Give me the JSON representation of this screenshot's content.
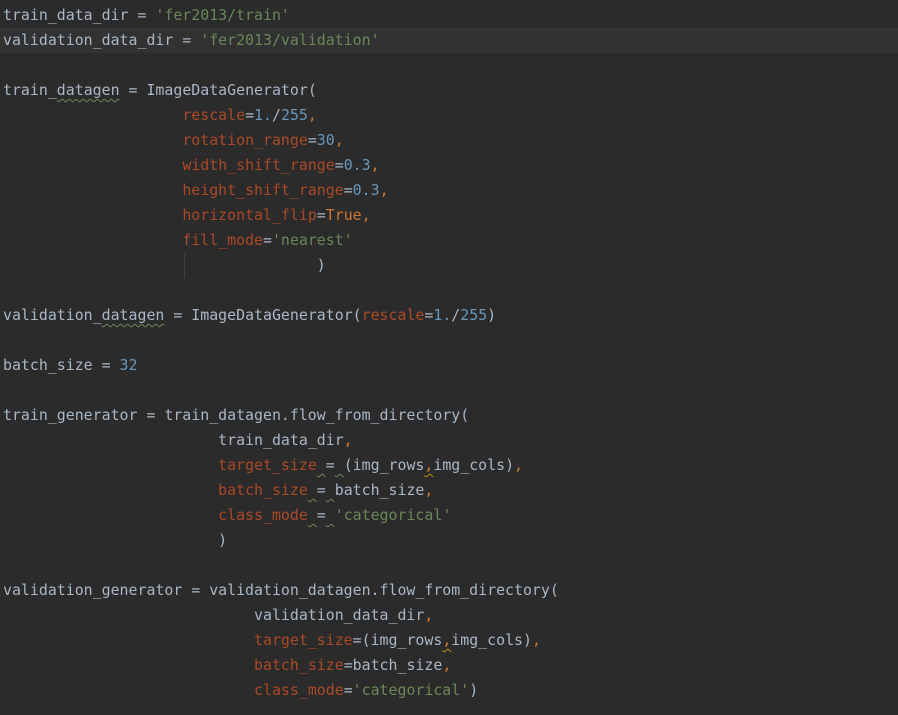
{
  "editor": {
    "theme": {
      "background": "#2b2b2b",
      "current_line": "#323232",
      "default_text": "#a9b7c6",
      "string": "#6a8759",
      "number": "#6897bb",
      "parameter": "#aa4926",
      "keyword_punct": "#cc7832"
    },
    "current_line_index": 1,
    "lines": [
      [
        {
          "t": "train_data_dir = ",
          "k": "default"
        },
        {
          "t": "'fer2013/train'",
          "k": "string"
        }
      ],
      [
        {
          "t": "validation_data_dir = ",
          "k": "default"
        },
        {
          "t": "'fer2013/validation'",
          "k": "string"
        }
      ],
      [],
      [
        {
          "t": "train_",
          "k": "default"
        },
        {
          "t": "datagen",
          "k": "default",
          "u": "weak"
        },
        {
          "t": " = ImageDataGenerator(",
          "k": "default"
        }
      ],
      [
        {
          "t": "                    ",
          "k": "default"
        },
        {
          "t": "rescale",
          "k": "param"
        },
        {
          "t": "=",
          "k": "default"
        },
        {
          "t": "1.",
          "k": "number"
        },
        {
          "t": "/",
          "k": "default"
        },
        {
          "t": "255",
          "k": "number"
        },
        {
          "t": ",",
          "k": "punct"
        }
      ],
      [
        {
          "t": "                    ",
          "k": "default"
        },
        {
          "t": "rotation_range",
          "k": "param"
        },
        {
          "t": "=",
          "k": "default"
        },
        {
          "t": "30",
          "k": "number"
        },
        {
          "t": ",",
          "k": "punct"
        }
      ],
      [
        {
          "t": "                    ",
          "k": "default"
        },
        {
          "t": "width_shift_range",
          "k": "param"
        },
        {
          "t": "=",
          "k": "default"
        },
        {
          "t": "0.3",
          "k": "number"
        },
        {
          "t": ",",
          "k": "punct"
        }
      ],
      [
        {
          "t": "                    ",
          "k": "default"
        },
        {
          "t": "height_shift_range",
          "k": "param"
        },
        {
          "t": "=",
          "k": "default"
        },
        {
          "t": "0.3",
          "k": "number"
        },
        {
          "t": ",",
          "k": "punct"
        }
      ],
      [
        {
          "t": "                    ",
          "k": "default"
        },
        {
          "t": "horizontal_flip",
          "k": "param"
        },
        {
          "t": "=",
          "k": "default"
        },
        {
          "t": "True",
          "k": "constant"
        },
        {
          "t": ",",
          "k": "punct"
        }
      ],
      [
        {
          "t": "                    ",
          "k": "default"
        },
        {
          "t": "fill_mode",
          "k": "param"
        },
        {
          "t": "=",
          "k": "default"
        },
        {
          "t": "'nearest'",
          "k": "string"
        }
      ],
      [
        {
          "t": "                                   )",
          "k": "default"
        }
      ],
      [],
      [
        {
          "t": "validation_",
          "k": "default"
        },
        {
          "t": "datagen",
          "k": "default",
          "u": "weak"
        },
        {
          "t": " = ImageDataGenerator(",
          "k": "default"
        },
        {
          "t": "rescale",
          "k": "param"
        },
        {
          "t": "=",
          "k": "default"
        },
        {
          "t": "1.",
          "k": "number"
        },
        {
          "t": "/",
          "k": "default"
        },
        {
          "t": "255",
          "k": "number"
        },
        {
          "t": ")",
          "k": "default"
        }
      ],
      [],
      [
        {
          "t": "batch_size = ",
          "k": "default"
        },
        {
          "t": "32",
          "k": "number"
        }
      ],
      [],
      [
        {
          "t": "train_generator = train_datagen.flow_from_directory(",
          "k": "default"
        }
      ],
      [
        {
          "t": "                        train_data_dir",
          "k": "default"
        },
        {
          "t": ",",
          "k": "punct"
        }
      ],
      [
        {
          "t": "                        ",
          "k": "default"
        },
        {
          "t": "target_size",
          "k": "param"
        },
        {
          "t": " ",
          "k": "default",
          "u": "weak"
        },
        {
          "t": "=",
          "k": "default"
        },
        {
          "t": " ",
          "k": "default",
          "u": "weak"
        },
        {
          "t": "(img_rows",
          "k": "default"
        },
        {
          "t": ",",
          "k": "punct",
          "u": "warn"
        },
        {
          "t": "img_cols)",
          "k": "default"
        },
        {
          "t": ",",
          "k": "punct"
        }
      ],
      [
        {
          "t": "                        ",
          "k": "default"
        },
        {
          "t": "batch_size",
          "k": "param"
        },
        {
          "t": " ",
          "k": "default",
          "u": "weak"
        },
        {
          "t": "=",
          "k": "default"
        },
        {
          "t": " ",
          "k": "default",
          "u": "weak"
        },
        {
          "t": "batch_size",
          "k": "default"
        },
        {
          "t": ",",
          "k": "punct"
        }
      ],
      [
        {
          "t": "                        ",
          "k": "default"
        },
        {
          "t": "class_mode",
          "k": "param"
        },
        {
          "t": " ",
          "k": "default",
          "u": "weak"
        },
        {
          "t": "=",
          "k": "default"
        },
        {
          "t": " ",
          "k": "default",
          "u": "weak"
        },
        {
          "t": "'categorical'",
          "k": "string"
        }
      ],
      [
        {
          "t": "                        )",
          "k": "default"
        }
      ],
      [],
      [
        {
          "t": "validation_generator = validation_datagen.flow_from_directory(",
          "k": "default"
        }
      ],
      [
        {
          "t": "                            validation_data_dir",
          "k": "default"
        },
        {
          "t": ",",
          "k": "punct"
        }
      ],
      [
        {
          "t": "                            ",
          "k": "default"
        },
        {
          "t": "target_size",
          "k": "param"
        },
        {
          "t": "=(img_rows",
          "k": "default"
        },
        {
          "t": ",",
          "k": "punct",
          "u": "warn"
        },
        {
          "t": "img_cols)",
          "k": "default"
        },
        {
          "t": ",",
          "k": "punct"
        }
      ],
      [
        {
          "t": "                            ",
          "k": "default"
        },
        {
          "t": "batch_size",
          "k": "param"
        },
        {
          "t": "=batch_size",
          "k": "default"
        },
        {
          "t": ",",
          "k": "punct"
        }
      ],
      [
        {
          "t": "                            ",
          "k": "default"
        },
        {
          "t": "class_mode",
          "k": "param"
        },
        {
          "t": "=",
          "k": "default"
        },
        {
          "t": "'categorical'",
          "k": "string"
        },
        {
          "t": ")",
          "k": "default"
        }
      ]
    ]
  }
}
